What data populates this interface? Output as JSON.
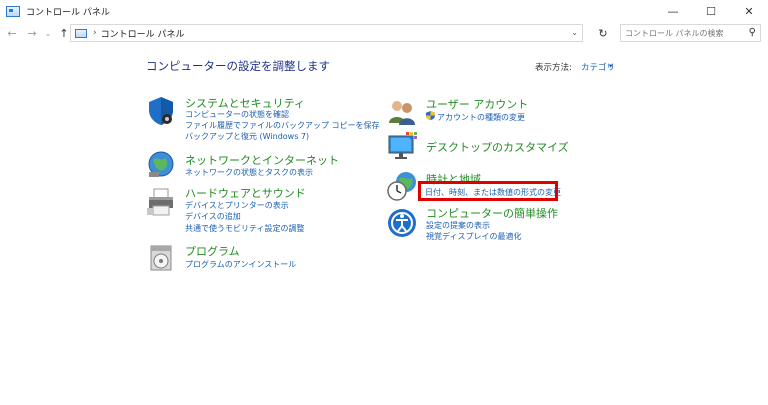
{
  "window": {
    "title": "コントロール パネル",
    "minimize": "—",
    "maximize": "☐",
    "close": "✕"
  },
  "nav": {
    "back": "←",
    "forward": "→",
    "recent": "⌄",
    "up": "↑",
    "breadcrumb_sep": "›",
    "breadcrumb": "コントロール パネル",
    "address_dropdown": "⌄",
    "refresh": "↻",
    "search_placeholder": "コントロール パネルの検索",
    "search_icon": "⚲"
  },
  "main": {
    "heading": "コンピューターの設定を調整します",
    "view_by_label": "表示方法:",
    "view_by_value": "カテゴリ",
    "view_by_caret": "▾"
  },
  "categories_left": [
    {
      "title": "システムとセキュリティ",
      "icon": "shield-icon",
      "links": [
        "コンピューターの状態を確認",
        "ファイル履歴でファイルのバックアップ コピーを保存",
        "バックアップと復元 (Windows 7)"
      ]
    },
    {
      "title": "ネットワークとインターネット",
      "icon": "network-globe-icon",
      "links": [
        "ネットワークの状態とタスクの表示"
      ]
    },
    {
      "title": "ハードウェアとサウンド",
      "icon": "printer-icon",
      "links": [
        "デバイスとプリンターの表示",
        "デバイスの追加",
        "共通で使うモビリティ設定の調整"
      ]
    },
    {
      "title": "プログラム",
      "icon": "programs-disc-icon",
      "links": [
        "プログラムのアンインストール"
      ]
    }
  ],
  "categories_right": [
    {
      "title": "ユーザー アカウント",
      "icon": "users-icon",
      "links": [
        "アカウントの種類の変更"
      ]
    },
    {
      "title": "デスクトップのカスタマイズ",
      "icon": "monitor-icon",
      "links": []
    },
    {
      "title": "時計と地域",
      "icon": "clock-globe-icon",
      "links": [
        "日付、時刻、または数値の形式の変更"
      ]
    },
    {
      "title": "コンピューターの簡単操作",
      "icon": "ease-of-access-icon",
      "links": [
        "設定の提案の表示",
        "視覚ディスプレイの最適化"
      ]
    }
  ],
  "colors": {
    "category_title": "#228b22",
    "link": "#1a5fb4",
    "heading": "#1e3287",
    "highlight": "#e00000"
  }
}
